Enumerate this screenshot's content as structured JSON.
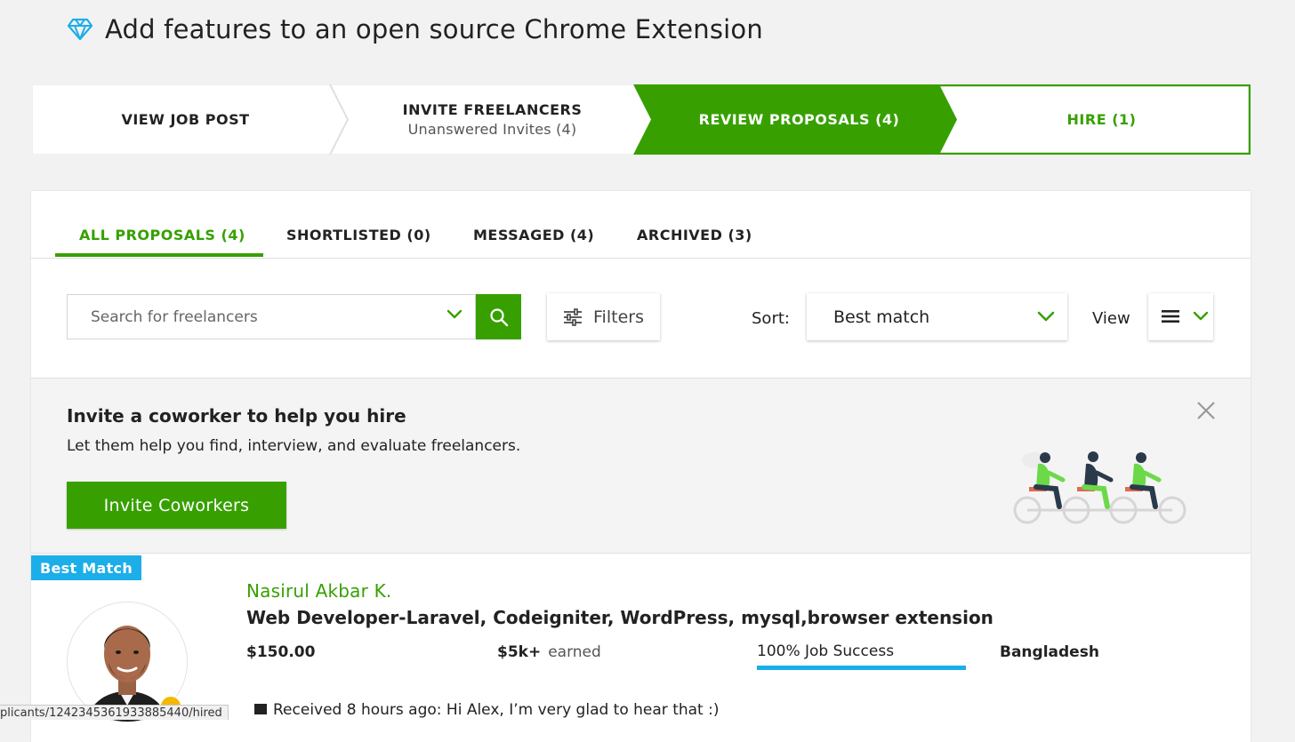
{
  "page": {
    "title": "Add features to an open source Chrome Extension",
    "icon": "diamond-icon",
    "accent_color": "#37a000",
    "info_color": "#1caee9"
  },
  "stepper": {
    "steps": [
      {
        "label": "VIEW JOB POST",
        "sub": ""
      },
      {
        "label": "INVITE FREELANCERS",
        "sub": "Unanswered Invites (4)"
      },
      {
        "label": "REVIEW PROPOSALS (4)",
        "sub": ""
      },
      {
        "label": "HIRE (1)",
        "sub": ""
      }
    ]
  },
  "tabs": [
    {
      "label": "ALL PROPOSALS (4)"
    },
    {
      "label": "SHORTLISTED (0)"
    },
    {
      "label": "MESSAGED (4)"
    },
    {
      "label": "ARCHIVED (3)"
    }
  ],
  "search": {
    "placeholder": "Search for freelancers",
    "value": ""
  },
  "filters": {
    "label": "Filters"
  },
  "sort": {
    "label": "Sort:",
    "value": "Best match"
  },
  "view": {
    "label": "View"
  },
  "invite": {
    "title": "Invite a coworker to help you hire",
    "subtitle": "Let them help you find, interview, and evaluate freelancers.",
    "button": "Invite Coworkers"
  },
  "proposal": {
    "badge": "Best Match",
    "name": "Nasirul Akbar K.",
    "title": "Web Developer-Laravel, Codeigniter, WordPress, mysql,browser extension",
    "rate": "$150.00",
    "earned_amount": "$5k+",
    "earned_label": "earned",
    "job_success": "100% Job Success",
    "job_success_fraction": 1.0,
    "country": "Bangladesh",
    "message": "Received 8 hours ago: Hi Alex, I’m very glad to hear that :)"
  },
  "status_bar": {
    "url": "plicants/1242345361933885440/hired"
  }
}
